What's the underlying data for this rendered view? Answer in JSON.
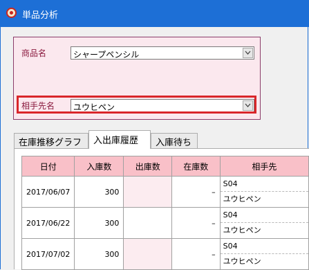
{
  "window": {
    "title": "単品分析",
    "icon": "app-logo-icon"
  },
  "filters": {
    "product_label": "商品名",
    "product_value": "シャープペンシル",
    "partner_label": "相手先名",
    "partner_value": "ユウヒペン"
  },
  "tabs": [
    {
      "label": "在庫推移グラフ",
      "active": false
    },
    {
      "label": "入出庫履歴",
      "active": true
    },
    {
      "label": "入庫待ち",
      "active": false
    }
  ],
  "table": {
    "columns": [
      "日付",
      "入庫数",
      "出庫数",
      "在庫数",
      "相手先"
    ],
    "rows": [
      {
        "date": "2017/06/07",
        "in": "300",
        "out": "",
        "stock": "–",
        "partner_code": "S04",
        "partner_name": "ユウヒペン"
      },
      {
        "date": "2017/06/22",
        "in": "300",
        "out": "",
        "stock": "–",
        "partner_code": "S04",
        "partner_name": "ユウヒペン"
      },
      {
        "date": "2017/07/02",
        "in": "300",
        "out": "",
        "stock": "–",
        "partner_code": "S04",
        "partner_name": "ユウヒペン"
      }
    ]
  },
  "colors": {
    "titlebar": "#1d6fd6",
    "panel_bg": "#fbe8ee",
    "highlight": "#d9262a",
    "header_bg": "#f9c0c8"
  }
}
